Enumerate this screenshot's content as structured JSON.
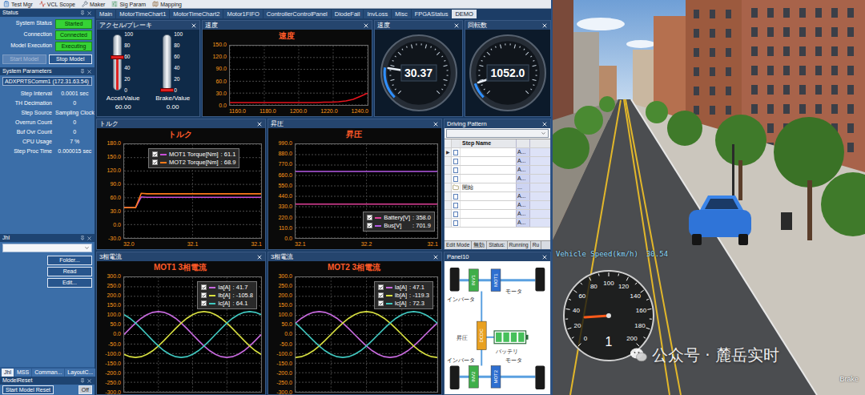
{
  "toolbar": [
    "Test Mgr",
    "VCL Scope",
    "Maker",
    "Sig Param",
    "Mapping"
  ],
  "status": {
    "title": "Status",
    "rows": [
      {
        "label": "System Status",
        "value": "Started"
      },
      {
        "label": "Connection",
        "value": "Connected"
      },
      {
        "label": "Model Execution",
        "value": "Executing"
      }
    ],
    "buttons": [
      {
        "label": "Start Model",
        "disabled": true
      },
      {
        "label": "Stop Model",
        "disabled": false
      }
    ]
  },
  "parameters": {
    "title": "System Parameters",
    "target": "ADXPRTSComm1 (172.31.63.54)",
    "rows": [
      {
        "label": "Step Interval",
        "value": "0.0001 sec"
      },
      {
        "label": "TH Decimation",
        "value": "0"
      },
      {
        "label": "Step Source",
        "value": "Sampling Clock"
      },
      {
        "label": "Overrun Count",
        "value": "0"
      },
      {
        "label": "Buf Ovr Count",
        "value": "0"
      },
      {
        "label": "CPU Usage",
        "value": "7 %"
      },
      {
        "label": "Step Proc Time",
        "value": "0.000015 sec"
      }
    ]
  },
  "jhl": {
    "title": "Jhl",
    "buttons": [
      "Folder...",
      "Read",
      "Edit..."
    ]
  },
  "sidebar_tabs": [
    {
      "label": "Jhl",
      "selected": true
    },
    {
      "label": "MSS",
      "selected": false
    },
    {
      "label": "Comman...",
      "selected": false
    },
    {
      "label": "LayoutC...",
      "selected": false
    }
  ],
  "model_reset": {
    "title": "ModelReset",
    "buttons": [
      "Start Model Reset",
      "Off"
    ]
  },
  "tabs": [
    {
      "label": "Main",
      "selected": false
    },
    {
      "label": "MotorTimeChart1",
      "selected": false
    },
    {
      "label": "MotorTimeChart2",
      "selected": false
    },
    {
      "label": "Motor1FIFO",
      "selected": false
    },
    {
      "label": "ControllerControlPanel",
      "selected": false
    },
    {
      "label": "DiodeFail",
      "selected": false
    },
    {
      "label": "InvLoss",
      "selected": false
    },
    {
      "label": "Misc",
      "selected": false
    },
    {
      "label": "FPGAStatus",
      "selected": false
    },
    {
      "label": "DEMO",
      "selected": true
    }
  ],
  "accel_brake": {
    "panel": "アクセル/ブレーキ",
    "scale": [
      "100",
      "80",
      "60",
      "40",
      "20",
      "0"
    ],
    "meters": [
      {
        "label": "Accel/Value",
        "value": "60.00",
        "level": 0.6
      },
      {
        "label": "Brake/Value",
        "value": "0.00",
        "level": 0
      }
    ]
  },
  "speed_chart": {
    "panel": "速度",
    "title": "速度",
    "y_ticks": [
      "150.0",
      "120.0",
      "90.0",
      "60.0",
      "30.0",
      "0.0"
    ],
    "x_ticks": [
      "1160.0",
      "1180.0",
      "1200.0",
      "1220.0",
      "1240.0"
    ],
    "series": [
      {
        "color": "#e8141e",
        "values": [
          6,
          6,
          6,
          6,
          6,
          6,
          6,
          6,
          6,
          6,
          6,
          6,
          6,
          7,
          7,
          8,
          10,
          14,
          22,
          30
        ]
      }
    ]
  },
  "gauges": [
    {
      "panel": "速度",
      "value": "30.37",
      "level": 0.2
    },
    {
      "panel": "回転数",
      "value": "1052.0",
      "level": 0.1
    }
  ],
  "torque_chart": {
    "panel": "トルク",
    "title": "トルク",
    "y_ticks": [
      "180.0",
      "150.0",
      "120.0",
      "90.0",
      "60.0",
      "30.0",
      "0.0",
      "-30.0"
    ],
    "x_ticks": [
      "32.0",
      "32.1",
      "32.1"
    ],
    "series": [
      {
        "label": "MOT1 Torque[Nm]",
        "reading": ": 61.1",
        "checked": true,
        "color": "#c84fd8",
        "values": [
          38,
          38,
          38,
          62,
          61,
          61,
          61,
          61,
          61,
          61,
          61,
          61,
          61,
          61,
          61,
          61,
          61,
          61,
          61,
          61,
          61,
          61,
          61,
          61,
          61
        ]
      },
      {
        "label": "MOT2 Torque[Nm]",
        "reading": ": 68.9",
        "checked": true,
        "color": "#ff7a1a",
        "values": [
          38,
          38,
          38,
          70,
          69,
          69,
          69,
          69,
          69,
          69,
          69,
          69,
          69,
          69,
          69,
          69,
          69,
          69,
          69,
          69,
          69,
          69,
          69,
          69,
          69
        ]
      }
    ]
  },
  "voltage_chart": {
    "panel": "昇圧",
    "title": "昇圧",
    "y_ticks": [
      "990.0",
      "880.0",
      "770.0",
      "660.0",
      "550.0",
      "440.0",
      "330.0",
      "220.0",
      "110.0",
      "0.0"
    ],
    "x_ticks": [
      "32.1",
      "32.2",
      "32.1"
    ],
    "series": [
      {
        "label": "Battery[V]",
        "reading": ": 358.0",
        "checked": true,
        "color": "#e0409a",
        "values": [
          358,
          358,
          358,
          358,
          358,
          358,
          358,
          358,
          358,
          358,
          358,
          358
        ]
      },
      {
        "label": "Bus[V]",
        "reading": ": 701.9",
        "checked": true,
        "color": "#b45ae6",
        "values": [
          702,
          702,
          702,
          702,
          702,
          702,
          702,
          702,
          702,
          702,
          702,
          702
        ]
      }
    ]
  },
  "driving_pattern": {
    "panel": "Driving Pattern",
    "column": "Step Name",
    "rows": [
      {
        "marker": "▶",
        "name": "",
        "value": "A...",
        "kind": "step"
      },
      {
        "marker": "",
        "name": "",
        "value": "A...",
        "kind": "step"
      },
      {
        "marker": "",
        "name": "",
        "value": "A...",
        "kind": "step"
      },
      {
        "marker": "",
        "name": "",
        "value": "A...",
        "kind": "step"
      },
      {
        "marker": "",
        "name": "開始",
        "value": "...",
        "kind": "group"
      },
      {
        "marker": "",
        "name": "",
        "value": "A...",
        "kind": "step"
      },
      {
        "marker": "",
        "name": "",
        "value": "A...",
        "kind": "step"
      },
      {
        "marker": "",
        "name": "",
        "value": "A...",
        "kind": "step"
      },
      {
        "marker": "",
        "name": "",
        "value": "A...",
        "kind": "step"
      }
    ],
    "footer": [
      "Edit Mode",
      "無効",
      "Status:",
      "Running",
      "Ru"
    ]
  },
  "current_charts": [
    {
      "panel": "3相電流",
      "title": "MOT1 3相電流",
      "y_ticks": [
        "300.0",
        "250.0",
        "200.0",
        "150.0",
        "100.0",
        "50.0",
        "0.0",
        "-50.0",
        "-100.0",
        "-150.0",
        "-200.0",
        "-250.0",
        "-300.0"
      ],
      "x_ticks": [],
      "series": [
        {
          "label": "Ia[A]",
          "reading": ": 41.7",
          "checked": true,
          "color": "#c86adf",
          "values": [
            0,
            31,
            60,
            85,
            104,
            116,
            120,
            116,
            104,
            85,
            60,
            31,
            0,
            -31,
            -60,
            -85,
            -104,
            -116,
            -120,
            -116,
            -104,
            -85,
            -60,
            -31,
            0
          ]
        },
        {
          "label": "Ib[A]",
          "reading": ": -105.8",
          "checked": true,
          "color": "#d8e040",
          "values": [
            -104,
            -116,
            -120,
            -116,
            -104,
            -85,
            -60,
            -31,
            0,
            31,
            60,
            85,
            104,
            116,
            120,
            116,
            104,
            85,
            60,
            31,
            0,
            -31,
            -60,
            -85,
            -104
          ]
        },
        {
          "label": "Ic[A]",
          "reading": ": 64.1",
          "checked": true,
          "color": "#40c8c0",
          "values": [
            104,
            85,
            60,
            31,
            0,
            -31,
            -60,
            -85,
            -104,
            -116,
            -120,
            -116,
            -104,
            -85,
            -60,
            -31,
            0,
            31,
            60,
            85,
            104,
            116,
            120,
            116,
            104
          ]
        }
      ]
    },
    {
      "panel": "3相電流",
      "title": "MOT2 3相電流",
      "y_ticks": [
        "300.0",
        "250.0",
        "200.0",
        "150.0",
        "100.0",
        "50.0",
        "0.0",
        "-50.0",
        "-100.0",
        "-150.0",
        "-200.0",
        "-250.0",
        "-300.0"
      ],
      "x_ticks": [],
      "series": [
        {
          "label": "Ia[A]",
          "reading": ": 47.1",
          "checked": true,
          "color": "#c86adf",
          "values": [
            60,
            85,
            104,
            116,
            120,
            116,
            104,
            85,
            60,
            31,
            0,
            -31,
            -60,
            -85,
            -104,
            -116,
            -120,
            -116,
            -104,
            -85,
            -60,
            -31,
            0,
            31,
            60
          ]
        },
        {
          "label": "Ib[A]",
          "reading": ": -119.3",
          "checked": true,
          "color": "#d8e040",
          "values": [
            -120,
            -116,
            -104,
            -85,
            -60,
            -31,
            0,
            31,
            60,
            85,
            104,
            116,
            120,
            116,
            104,
            85,
            60,
            31,
            0,
            -31,
            -60,
            -85,
            -104,
            -116,
            -120
          ]
        },
        {
          "label": "Ic[A]",
          "reading": ": 72.3",
          "checked": true,
          "color": "#40c8c0",
          "values": [
            60,
            31,
            0,
            -31,
            -60,
            -85,
            -104,
            -116,
            -120,
            -116,
            -104,
            -85,
            -60,
            -31,
            0,
            31,
            60,
            85,
            104,
            116,
            120,
            116,
            104,
            85,
            60
          ]
        }
      ]
    }
  ],
  "panel10": {
    "panel": "Panel10",
    "labels": {
      "inverter_top": "インバータ",
      "motor_top": "モータ",
      "boost": "昇圧",
      "battery": "バッテリ",
      "motor_bottom": "モータ",
      "inverter_bottom": "インバータ"
    },
    "blocks": [
      {
        "label": "INV1",
        "color": "#3fae49"
      },
      {
        "label": "MOT1",
        "color": "#2f6fd0"
      },
      {
        "label": "DCDC",
        "color": "#e8a020"
      },
      {
        "label": "INV2",
        "color": "#3fae49"
      },
      {
        "label": "MOT2",
        "color": "#2f6fd0"
      }
    ]
  },
  "scene": {
    "speed_label": "Vehicle Speed(km/h)",
    "speed_value": "30.54",
    "dial": {
      "ticks": [
        "0",
        "20",
        "40",
        "60",
        "80",
        "100",
        "120",
        "140",
        "160",
        "180",
        "200"
      ],
      "gear": "1",
      "level": 0.153
    },
    "brake": "Brake",
    "watermark": "公众号 · 麓岳实时"
  }
}
